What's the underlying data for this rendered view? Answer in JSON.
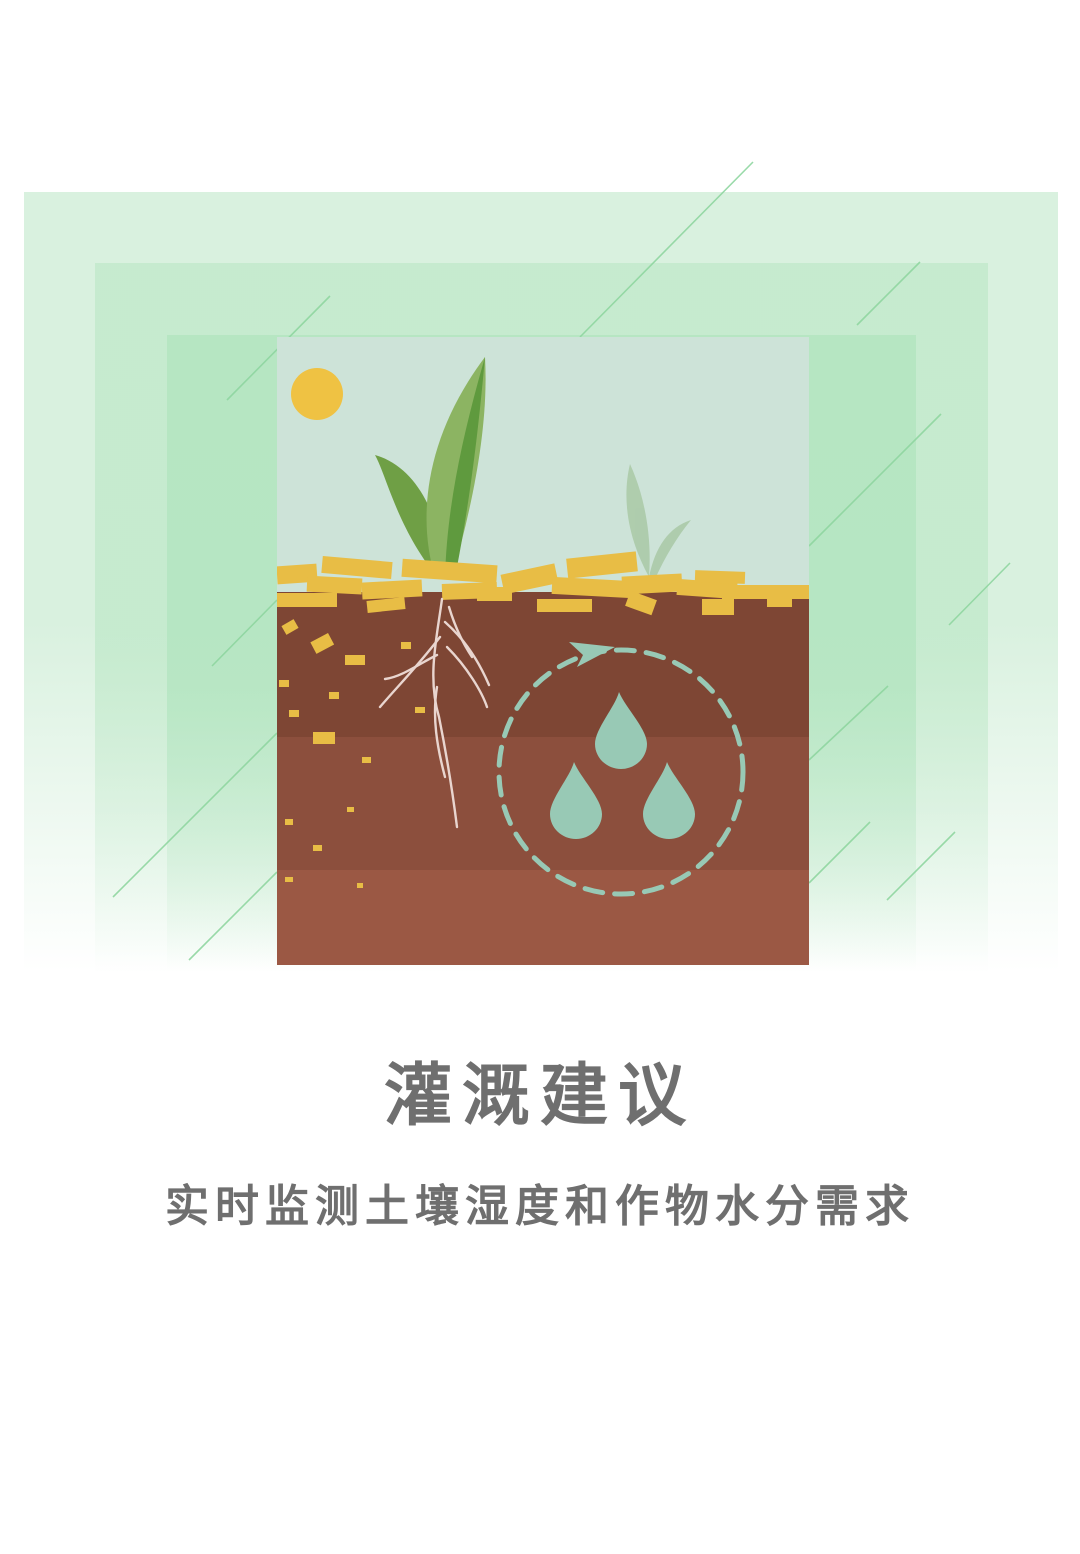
{
  "title": "灌溉建议",
  "subtitle": "实时监测土壤湿度和作物水分需求",
  "illustration": {
    "icons": [
      "sun-icon",
      "plant-icon",
      "roots-icon",
      "water-drops-icon",
      "cycle-arrow-icon"
    ],
    "colors": {
      "sky": "#cde3d8",
      "sun": "#efc243",
      "leaf": "#8cb462",
      "leaf_dark": "#5f9a3e",
      "straw": "#e8bd45",
      "soil_top": "#7e4634",
      "soil_mid": "#8c4f3d",
      "soil_bottom": "#9b5844",
      "water": "#98c9b5",
      "frame_green": "#c6ebd0"
    }
  }
}
